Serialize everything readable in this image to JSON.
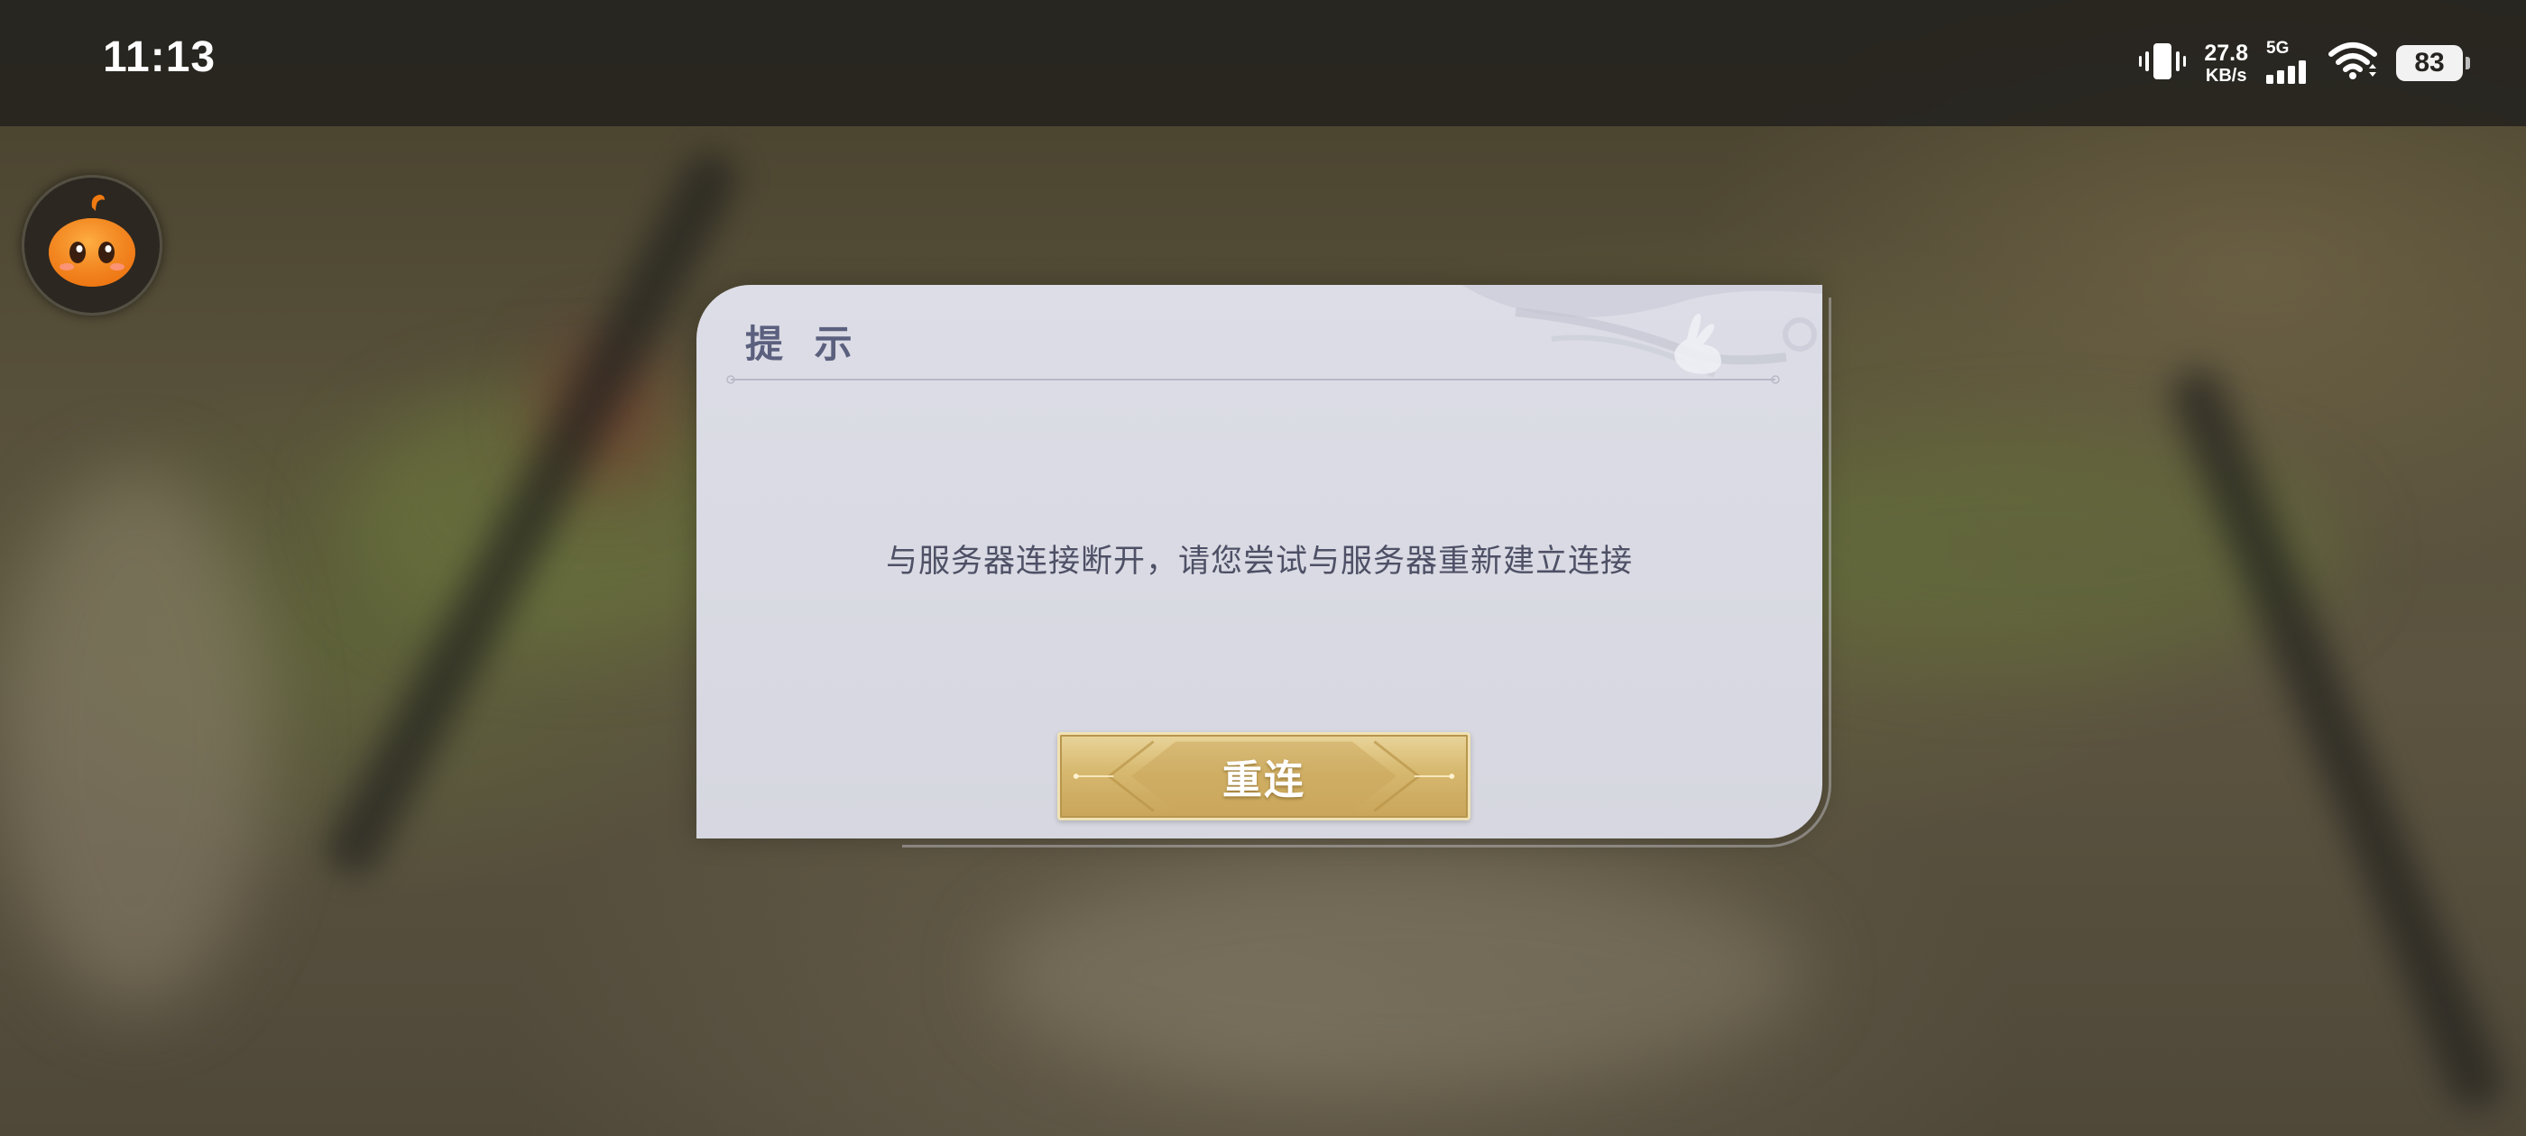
{
  "status_bar": {
    "time": "11:13",
    "net_speed_value": "27.8",
    "net_speed_unit": "KB/s",
    "network_type": "5G",
    "battery_level": "83",
    "icons": [
      "vibrate-icon",
      "signal-icon",
      "wifi-icon",
      "battery-icon"
    ]
  },
  "assistant": {
    "icon": "pumpkin-mascot-icon"
  },
  "dialog": {
    "title": "提 示",
    "message": "与服务器连接断开，请您尝试与服务器重新建立连接",
    "button_label": "重连",
    "colors": {
      "panel": "#d9dae3",
      "title": "#5b607e",
      "message": "#4e5066",
      "button_gold": "#d6b86e"
    }
  }
}
